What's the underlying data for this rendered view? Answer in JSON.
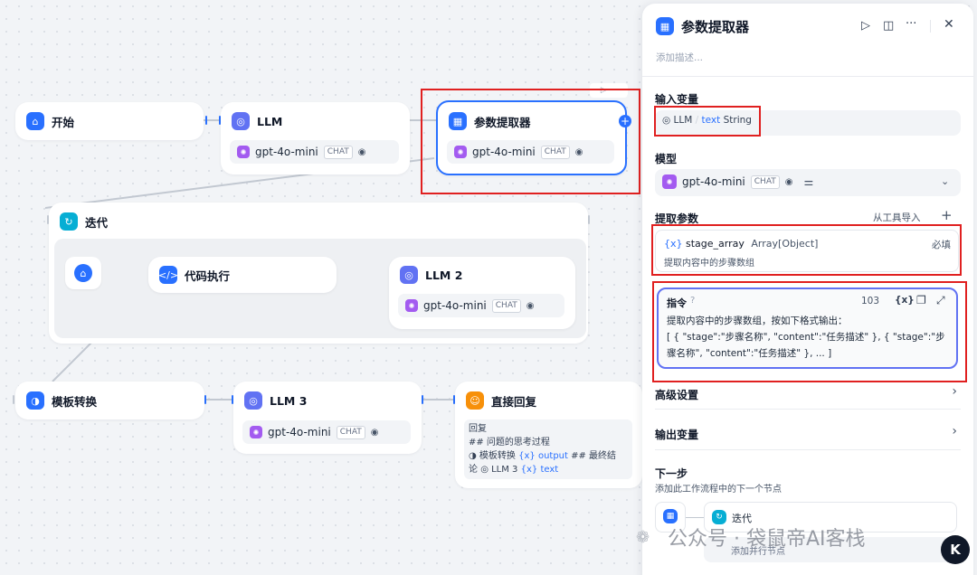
{
  "canvas": {
    "start": {
      "title": "开始"
    },
    "llm": {
      "title": "LLM",
      "model": "gpt-4o-mini",
      "tag": "CHAT"
    },
    "extractor": {
      "title": "参数提取器",
      "model": "gpt-4o-mini",
      "tag": "CHAT"
    },
    "iteration": {
      "title": "迭代"
    },
    "code": {
      "title": "代码执行"
    },
    "llm2": {
      "title": "LLM 2",
      "model": "gpt-4o-mini",
      "tag": "CHAT"
    },
    "template": {
      "title": "模板转换"
    },
    "llm3": {
      "title": "LLM 3",
      "model": "gpt-4o-mini",
      "tag": "CHAT"
    },
    "answer": {
      "title": "直接回复",
      "line1": "回复",
      "line2": "## 问题的思考过程",
      "var1_node": "模板转换",
      "var1_name": "output",
      "line3_suffix": "## 最终结",
      "line4_prefix": "论",
      "var2_node": "LLM 3",
      "var2_name": "text"
    }
  },
  "panel": {
    "title": "参数提取器",
    "description_placeholder": "添加描述...",
    "input_section": "输入变量",
    "input_var": {
      "node": "LLM",
      "name": "text",
      "type": "String"
    },
    "model_section": "模型",
    "model": {
      "name": "gpt-4o-mini",
      "tag": "CHAT"
    },
    "extract_section": "提取参数",
    "import_from_tool": "从工具导入",
    "param": {
      "name": "stage_array",
      "type": "Array[Object]",
      "required": "必填",
      "desc": "提取内容中的步骤数组"
    },
    "instruction": {
      "label": "指令",
      "count": "103",
      "text_line1": "提取内容中的步骤数组，按如下格式输出：",
      "text_line2": "[ { \"stage\":\"步骤名称\", \"content\":\"任务描述\" }, { \"stage\":\"步",
      "text_line3": "骤名称\", \"content\":\"任务描述\" }, ... ]"
    },
    "advanced": "高级设置",
    "output_vars": "输出变量",
    "next_step": "下一步",
    "next_step_desc": "添加此工作流程中的下一个节点",
    "next_node": "迭代",
    "add_parallel": "添加并行节点"
  },
  "watermark": "公众号 · 袋鼠帝AI客栈"
}
